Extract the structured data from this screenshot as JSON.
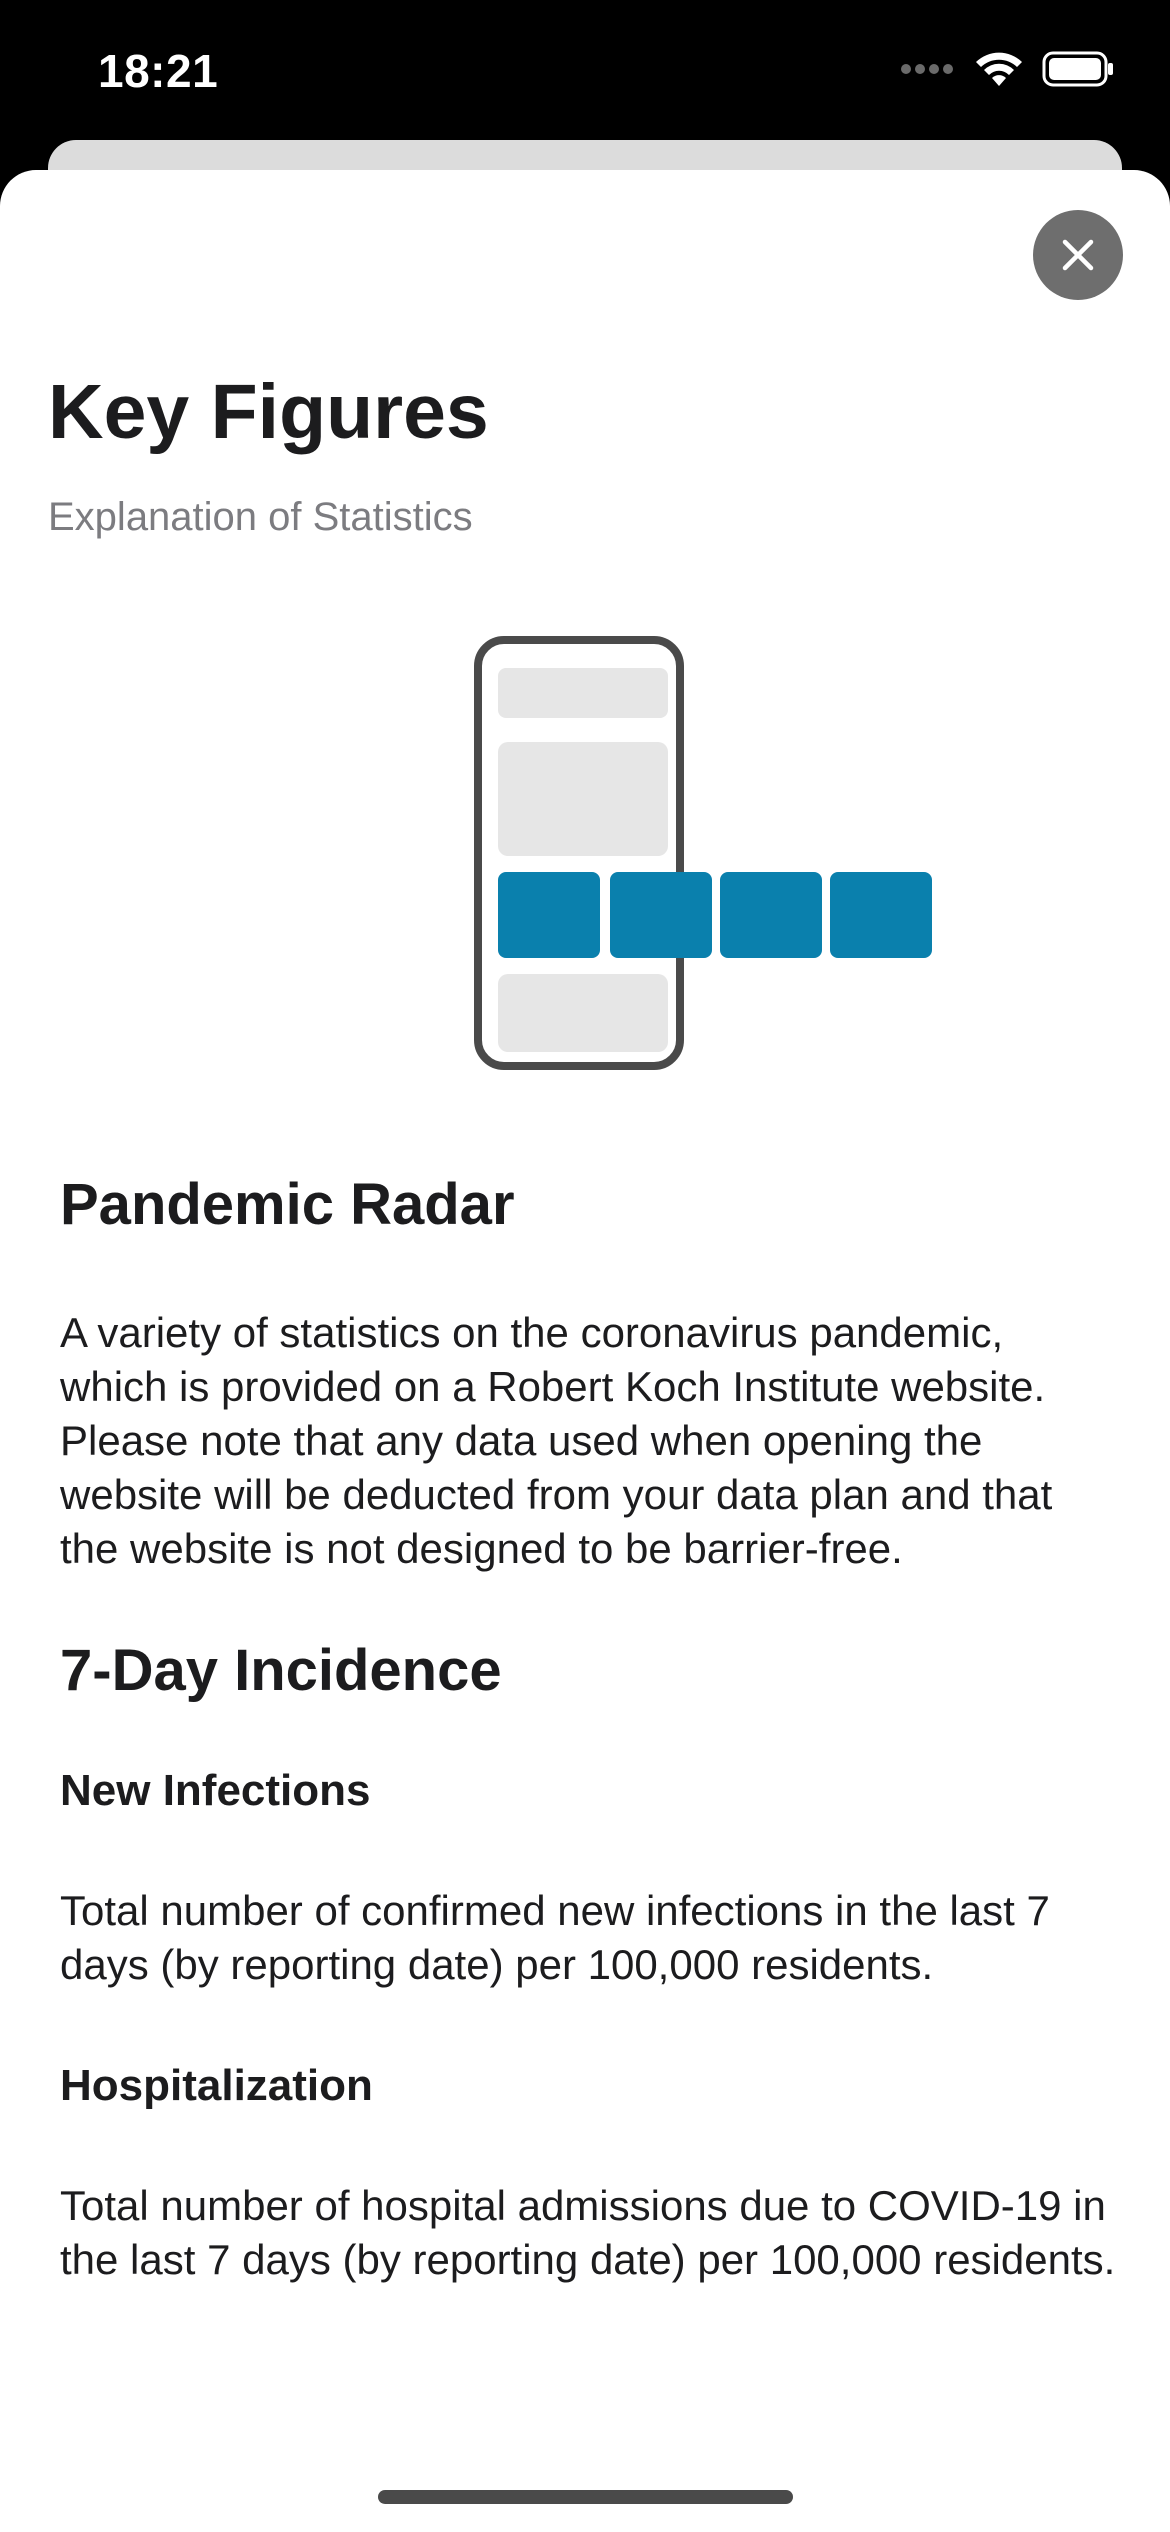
{
  "status_bar": {
    "time": "18:21"
  },
  "header": {
    "title": "Key Figures",
    "subtitle": "Explanation of Statistics"
  },
  "icons": {
    "close": "close-icon",
    "illustration": "phone-tiles-illustration",
    "wifi": "wifi-icon",
    "battery": "battery-icon",
    "signal": "signal-icon"
  },
  "colors": {
    "accent": "#0a80ad",
    "tile_gray": "#e6e6e6",
    "close_button": "#6e6e6e",
    "subtitle": "#7c7c80"
  },
  "sections": {
    "pandemic_radar": {
      "title": "Pandemic Radar",
      "paragraph1": "A variety of statistics on the coronavirus pandemic, which is provided on a Robert Koch Institute website.",
      "paragraph2": "Please note that any data used when opening the website will be deducted from your data plan and that the website is not designed to be barrier-free."
    },
    "incidence": {
      "title": "7-Day Incidence",
      "new_infections": {
        "title": "New Infections",
        "text": "Total number of confirmed new infections in the last 7 days (by reporting date) per 100,000 residents."
      },
      "hospitalization": {
        "title": "Hospitalization",
        "text": "Total number of hospital admissions due to COVID-19 in the last 7 days (by reporting date) per 100,000 residents."
      }
    }
  }
}
